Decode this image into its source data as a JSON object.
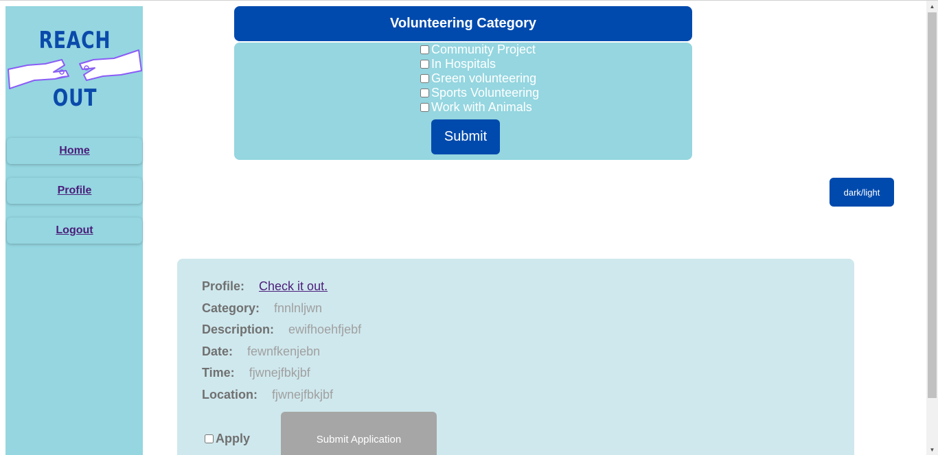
{
  "sidebar": {
    "logo": {
      "line1": "REACH",
      "line2": "OUT",
      "accent_color": "#8a5cf6",
      "text_color": "#0a4aab"
    },
    "nav": [
      {
        "label": "Home"
      },
      {
        "label": "Profile"
      },
      {
        "label": "Logout"
      }
    ]
  },
  "category": {
    "title": "Volunteering Category",
    "options": [
      {
        "label": "Community Project",
        "checked": false
      },
      {
        "label": "In Hospitals",
        "checked": false
      },
      {
        "label": "Green volunteering",
        "checked": false
      },
      {
        "label": "Sports Volunteering",
        "checked": false
      },
      {
        "label": "Work with Animals",
        "checked": false
      }
    ],
    "submit_label": "Submit"
  },
  "theme_toggle_label": "dark/light",
  "listing": {
    "profile_label": "Profile:",
    "profile_link": "Check it out.",
    "fields": [
      {
        "label": "Category:",
        "value": "fnnlnljwn"
      },
      {
        "label": "Description:",
        "value": "ewifhoehfjebf"
      },
      {
        "label": "Date:",
        "value": "fewnfkenjebn"
      },
      {
        "label": "Time:",
        "value": "fjwnejfbkjbf"
      },
      {
        "label": "Location:",
        "value": "fjwnejfbkjbf"
      }
    ],
    "apply_label": "Apply",
    "submit_application_label": "Submit Application"
  },
  "colors": {
    "primary": "#004aad",
    "panel": "#95d6e0",
    "card": "#cfe8ed",
    "disabled_button": "#a6a6a6"
  }
}
